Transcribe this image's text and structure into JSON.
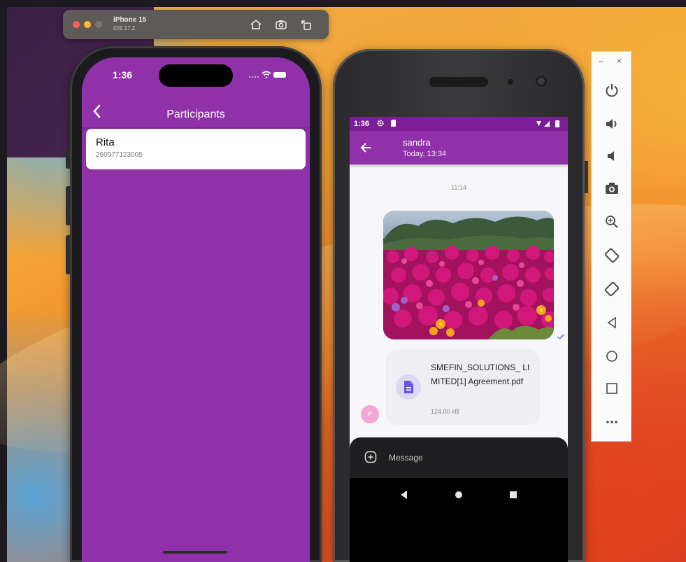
{
  "simulator_toolbar": {
    "device_name": "iPhone 15",
    "os_version": "iOS 17.2"
  },
  "ios_app": {
    "status_time": "1:36",
    "title": "Participants",
    "participants": [
      {
        "name": "Rita",
        "phone": "260977123005"
      }
    ]
  },
  "android_app": {
    "status_time": "1:36",
    "contact_name": "sandra",
    "contact_subtitle": "Today, 13:34",
    "time_separator": "11:14",
    "file_message": {
      "file_name": "SMEFIN_SOLUTIONS_ LIMITED[1] Agreement.pdf",
      "file_size": "124.00 kB"
    },
    "sender_avatar_initial": "P",
    "composer_placeholder": "Message"
  },
  "emulator_panel": {
    "window_controls": [
      "–",
      "×"
    ],
    "buttons": [
      "power-icon",
      "volume-up-icon",
      "volume-down-icon",
      "camera-icon",
      "zoom-icon",
      "rotate-left-icon",
      "rotate-right-icon",
      "back-icon",
      "home-icon",
      "overview-icon",
      "more-icon"
    ]
  },
  "colors": {
    "app_purple": "#9031aa",
    "status_purple": "#7e1e97",
    "composer_dark": "#1e1e20"
  }
}
